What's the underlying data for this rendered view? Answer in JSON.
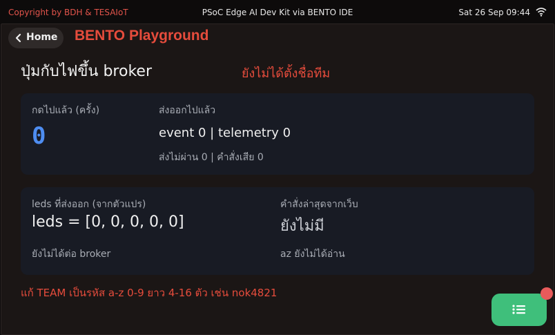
{
  "status_bar": {
    "copyright": "Copyright by BDH & TESAIoT",
    "device": "PSoC Edge AI Dev Kit via BENTO IDE",
    "datetime": "Sat 26 Sep 09:44",
    "wifi_icon": "wifi-icon"
  },
  "header": {
    "home_label": "Home",
    "app_title": "BENTO Playground"
  },
  "page": {
    "title": "ปุ่มกับไฟขึ้น broker",
    "team_warning": "ยังไม่ได้ตั้งชื่อทีม"
  },
  "press_card": {
    "pressed_label": "กดไปแล้ว (ครั้ง)",
    "pressed_count": "0",
    "sent_label": "ส่งออกไปแล้ว",
    "sent_summary": "event 0 | telemetry 0",
    "failed_summary": "ส่งไม่ผ่าน 0 | คำสั่งเสีย 0"
  },
  "led_card": {
    "leds_label": "leds ที่ส่งออก (จากตัวแปร)",
    "leds_value": "leds = [0, 0, 0, 0, 0]",
    "broker_status": "ยังไม่ได้ต่อ broker",
    "web_cmd_label": "คำสั่งล่าสุดจากเว็บ",
    "web_cmd_value": "ยังไม่มี",
    "az_status": "az ยังไม่ได้อ่าน"
  },
  "footer": {
    "team_hint": "แก้ TEAM เป็นรหัส a-z 0-9 ยาว 4-16 ตัว เช่น nok4821"
  },
  "colors": {
    "accent_red": "#e64c3c",
    "counter_blue": "#4e8df1",
    "fab_green": "#3fbf7b",
    "badge_red": "#e85b5b",
    "card_bg": "#181b24"
  }
}
